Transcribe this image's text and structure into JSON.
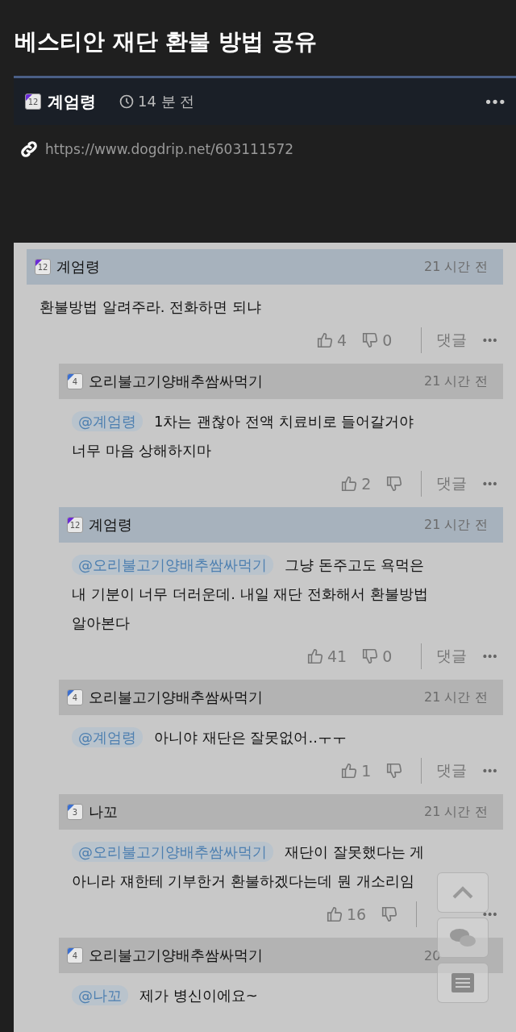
{
  "post": {
    "title": "베스티안 재단 환불 방법 공유",
    "author": "계엄령",
    "author_badge": {
      "text": "12",
      "color": "#6a2bd6"
    },
    "time": "14 분 전",
    "more": "•••",
    "url": "https://www.dogdrip.net/603111572"
  },
  "comments": [
    {
      "author": "계엄령",
      "badge": {
        "text": "12",
        "color": "#6a2bd6"
      },
      "time": "21 시간 전",
      "highlighted": true,
      "text": "환불방법 알려주라. 전화하면 되냐",
      "likes": "4",
      "dislikes": "0",
      "reply": "댓글",
      "more": "•••",
      "children": [
        {
          "author": "오리불고기양배추쌈싸먹기",
          "badge": {
            "text": "4",
            "color": "#3b6fd0"
          },
          "time": "21 시간 전",
          "highlighted": false,
          "mention": "@계엄령",
          "text": "1차는 괜찮아 전액 치료비로 들어갈거야 너무 마음 상해하지마",
          "likes": "2",
          "reply": "댓글",
          "more": "•••"
        },
        {
          "author": "계엄령",
          "badge": {
            "text": "12",
            "color": "#6a2bd6"
          },
          "time": "21 시간 전",
          "highlighted": true,
          "mention": "@오리불고기양배추쌈싸먹기",
          "text": "그냥 돈주고도 욕먹은 내 기분이 너무 더러운데. 내일 재단 전화해서 환불방법 알아본다",
          "likes": "41",
          "dislikes": "0",
          "reply": "댓글",
          "more": "•••"
        },
        {
          "author": "오리불고기양배추쌈싸먹기",
          "badge": {
            "text": "4",
            "color": "#3b6fd0"
          },
          "time": "21 시간 전",
          "highlighted": false,
          "mention": "@계엄령",
          "text": "아니야 재단은 잘못없어..ㅜㅜ",
          "likes": "1",
          "reply": "댓글",
          "more": "•••"
        },
        {
          "author": "나꼬",
          "badge": {
            "text": "3",
            "color": "#3b6fd0"
          },
          "time": "21 시간 전",
          "highlighted": false,
          "mention": "@오리불고기양배추쌈싸먹기",
          "text": "재단이 잘못했다는 게 아니라 쟤한테 기부한거 환불하겠다는데 뭔 개소리임",
          "likes": "16",
          "more": "•••"
        },
        {
          "author": "오리불고기양배추쌈싸먹기",
          "badge": {
            "text": "4",
            "color": "#3b6fd0"
          },
          "time": "20",
          "highlighted": false,
          "mention": "@나꼬",
          "text": "제가 병신이에요~"
        }
      ]
    }
  ]
}
